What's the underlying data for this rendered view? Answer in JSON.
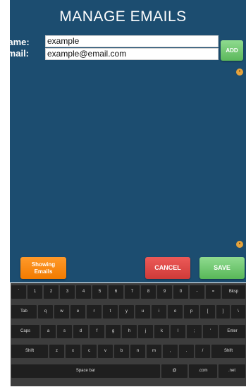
{
  "title": "MANAGE EMAILS",
  "form": {
    "name_label": "Name:",
    "name_value": "example",
    "email_label": "Email:",
    "email_value": "example@email.com",
    "add_label": "ADD"
  },
  "buttons": {
    "showing_line1": "Showing",
    "showing_line2": "Emails",
    "cancel_label": "CANCEL",
    "save_label": "SAVE"
  },
  "colors": {
    "panel": "#1c4d70",
    "add": "#6cc46c",
    "showing": "#f5850f",
    "cancel": "#d9423f",
    "save": "#66c166",
    "key": "#1f1f1f",
    "keyboard_bg": "#3d3d3d"
  },
  "keyboard": {
    "rows": [
      [
        "`",
        "1",
        "2",
        "3",
        "4",
        "5",
        "6",
        "7",
        "8",
        "9",
        "0",
        "-",
        "=",
        "Bksp"
      ],
      [
        "Tab",
        "q",
        "w",
        "e",
        "r",
        "t",
        "y",
        "u",
        "i",
        "o",
        "p",
        "[",
        "]",
        "\\"
      ],
      [
        "Caps",
        "a",
        "s",
        "d",
        "f",
        "g",
        "h",
        "j",
        "k",
        "l",
        ";",
        "'",
        "Enter"
      ],
      [
        "Shift",
        "z",
        "x",
        "c",
        "v",
        "b",
        "n",
        "m",
        ",",
        ".",
        "/",
        "Shift"
      ],
      [
        "Space bar",
        "@",
        ".com",
        ".net"
      ]
    ]
  }
}
